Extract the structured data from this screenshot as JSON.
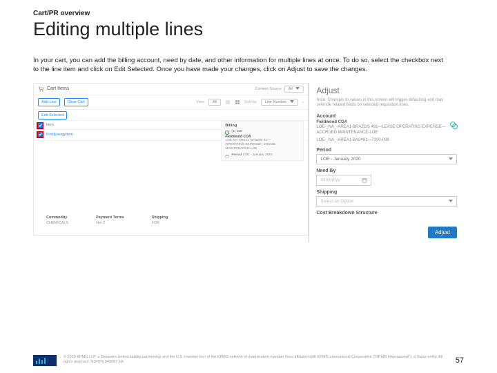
{
  "kicker": "Cart/PR overview",
  "title": "Editing multiple lines",
  "body": "In your cart, you can add the billing account, need by date, and other information for multiple lines at once. To do so, select the checkbox next to the line item and click on Edit Selected. Once you have made your changes, click on Adjust to save the changes.",
  "cart": {
    "title_text": "Cart Items",
    "content_source": "Content Source",
    "all_label": "All",
    "add_line": "Add Line",
    "clear_cart": "Clear Cart",
    "view_label": "View",
    "view_value": "All",
    "sort_by": "Sort by",
    "sort_value": "Line Number",
    "edit_selected": "Edit Selected",
    "line1_name": "Item",
    "line2_name": "FirstEnergyItem",
    "billing_header": "Billing",
    "coa_name": "Fieldwood COA",
    "coa_line1": "LOE-NA-AREA1-BA0296-41—",
    "coa_line2": "OPERATING EXPENSE—DEASE",
    "coa_line3": "MAINTENANCE-LOE",
    "period_label": "Period",
    "period_value": "LOE - January 2020",
    "commodity_lbl": "Commodity",
    "commodity_val": "CHEMICALS",
    "payterms_lbl": "Payment Terms",
    "payterms_val": "Net 2",
    "shipping_lbl": "Shipping",
    "shipping_val": "FOB"
  },
  "panel": {
    "heading": "Adjust",
    "note": "Note: Changes to values in this screen will trigger defaulting and may override related fields on selected requisition lines.",
    "account_label": "Account",
    "account_name": "Fieldwood COA",
    "account_line1": "LOE-_NA_-AREA1-BRAZOS 491—LEASE OPERATING EXPENSE—ACCRUED MAINTENANCE-LOE",
    "account_line2": "LOE-_NA_-AREA1-BA0491—7200-098",
    "period_label": "Period",
    "period_value": "LOE - January 2020",
    "needby_label": "Need By",
    "needby_placeholder": "mm/dd/yy",
    "shipping_label": "Shipping",
    "shipping_value": "Select an Option",
    "cbs_label": "Cost Breakdown Structure",
    "adjust_btn": "Adjust"
  },
  "footer": {
    "copyright": "© 2020 KPMG LLP, a Delaware limited liability partnership and the U.S. member firm of the KPMG network of independent member firms affiliated with KPMG International Cooperative (\"KPMG International\"), a Swiss entity. All rights reserved. NDPPS 843087-1A",
    "page": "57"
  }
}
